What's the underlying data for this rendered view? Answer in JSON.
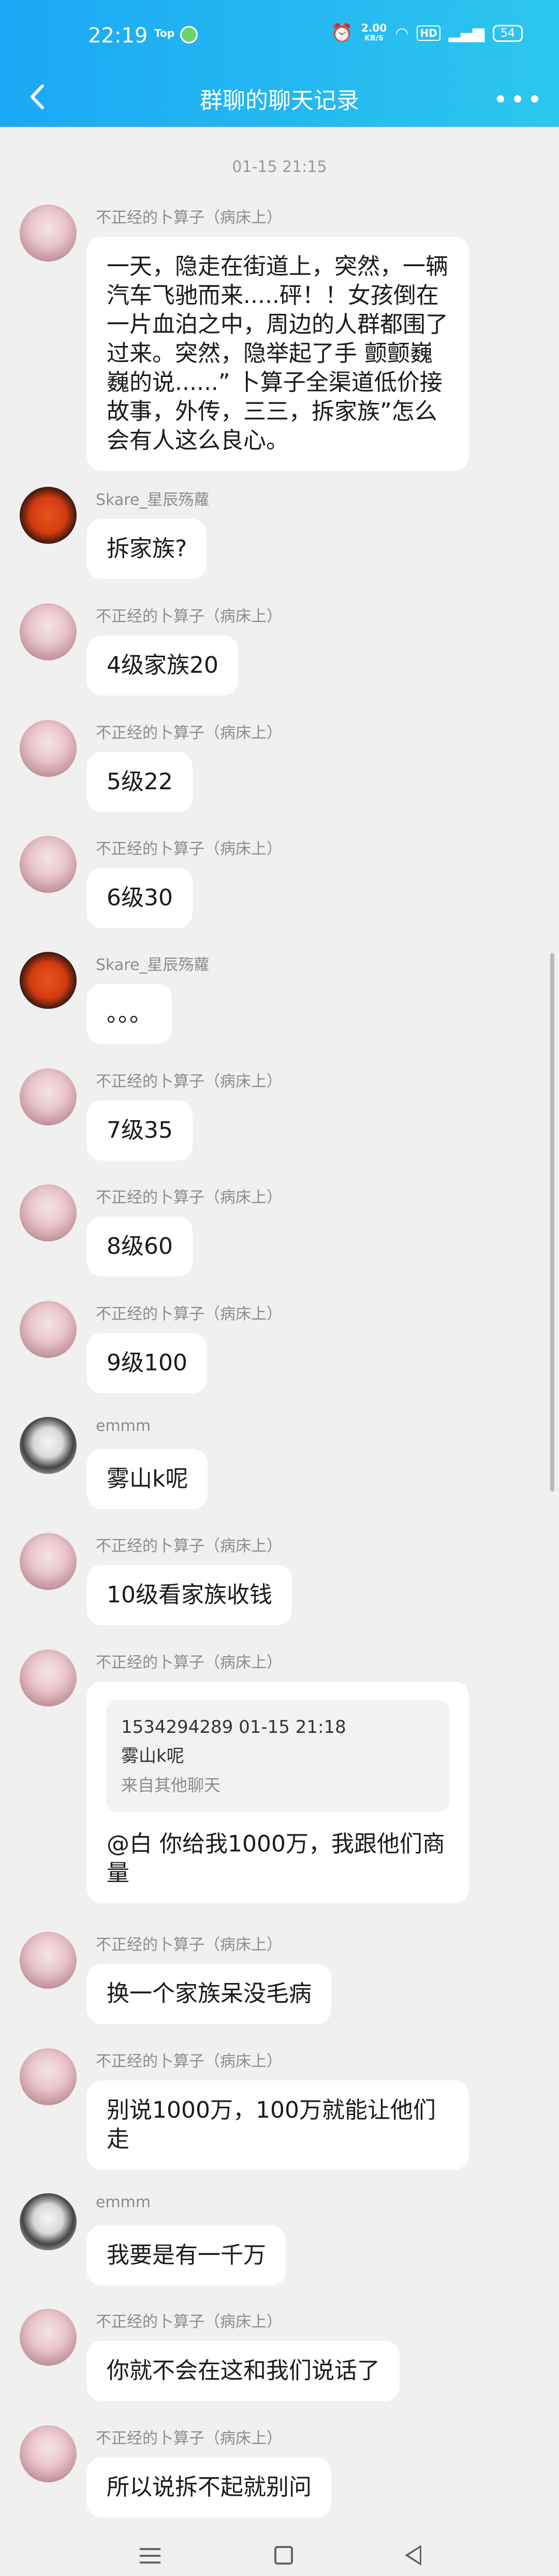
{
  "status": {
    "time": "22:19",
    "app_label": "Top",
    "net_speed_top": "2.00",
    "net_speed_unit": "KB/S",
    "hd": "HD",
    "battery": "54"
  },
  "header": {
    "title": "群聊的聊天记录"
  },
  "timestamp": "01-15 21:15",
  "messages": [
    {
      "sender": "不正经的卜算子（病床上）",
      "text": "一天，隐走在街道上，突然，一辆汽车飞驰而来.....砰！！女孩倒在一片血泊之中，周边的人群都围了过来。突然，隐举起了手 颤颤巍巍的说......” 卜算子全渠道低价接故事，外传，三三，拆家族”怎么会有人这么良心。"
    },
    {
      "sender": "Skare_星辰殇蘿",
      "text": "拆家族?"
    },
    {
      "sender": "不正经的卜算子（病床上）",
      "text": "4级家族20"
    },
    {
      "sender": "不正经的卜算子（病床上）",
      "text": "5级22"
    },
    {
      "sender": "不正经的卜算子（病床上）",
      "text": "6级30"
    },
    {
      "sender": "Skare_星辰殇蘿",
      "text": "。。。"
    },
    {
      "sender": "不正经的卜算子（病床上）",
      "text": "7级35"
    },
    {
      "sender": "不正经的卜算子（病床上）",
      "text": "8级60"
    },
    {
      "sender": "不正经的卜算子（病床上）",
      "text": "9级100"
    },
    {
      "sender": "emmm",
      "text": "雾山k呢"
    },
    {
      "sender": "不正经的卜算子（病床上）",
      "text": "10级看家族收钱"
    },
    {
      "sender": "不正经的卜算子（病床上）",
      "quote_head": "1534294289 01-15 21:18",
      "quote_text": "雾山k呢",
      "quote_source": "来自其他聊天",
      "text": "@白 你给我1000万，我跟他们商量"
    },
    {
      "sender": "不正经的卜算子（病床上）",
      "text": "换一个家族呆没毛病"
    },
    {
      "sender": "不正经的卜算子（病床上）",
      "text": "别说1000万，100万就能让他们走"
    },
    {
      "sender": "emmm",
      "text": "我要是有一千万"
    },
    {
      "sender": "不正经的卜算子（病床上）",
      "text": "你就不会在这和我们说话了"
    },
    {
      "sender": "不正经的卜算子（病床上）",
      "text": "所以说拆不起就别问"
    }
  ]
}
